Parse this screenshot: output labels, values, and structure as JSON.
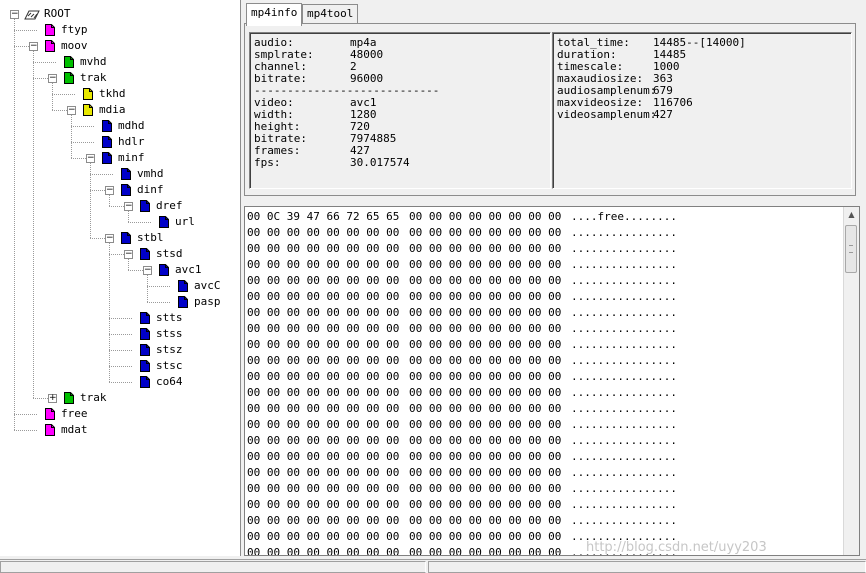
{
  "tree": {
    "root": "ROOT",
    "nodes": [
      {
        "label": "ftyp",
        "color": "#ff00ff"
      },
      {
        "label": "moov",
        "color": "#ff00ff"
      },
      {
        "label": "mvhd",
        "color": "#00c000"
      },
      {
        "label": "trak",
        "color": "#00c000"
      },
      {
        "label": "tkhd",
        "color": "#e8e800"
      },
      {
        "label": "mdia",
        "color": "#e8e800"
      },
      {
        "label": "mdhd",
        "color": "#0000c8"
      },
      {
        "label": "hdlr",
        "color": "#0000c8"
      },
      {
        "label": "minf",
        "color": "#0000c8"
      },
      {
        "label": "vmhd",
        "color": "#0000c8"
      },
      {
        "label": "dinf",
        "color": "#0000c8"
      },
      {
        "label": "dref",
        "color": "#0000c8"
      },
      {
        "label": "url",
        "color": "#0000c8"
      },
      {
        "label": "stbl",
        "color": "#0000c8"
      },
      {
        "label": "stsd",
        "color": "#0000c8"
      },
      {
        "label": "avc1",
        "color": "#0000c8"
      },
      {
        "label": "avcC",
        "color": "#0000c8"
      },
      {
        "label": "pasp",
        "color": "#0000c8"
      },
      {
        "label": "stts",
        "color": "#0000c8"
      },
      {
        "label": "stss",
        "color": "#0000c8"
      },
      {
        "label": "stsz",
        "color": "#0000c8"
      },
      {
        "label": "stsc",
        "color": "#0000c8"
      },
      {
        "label": "co64",
        "color": "#0000c8"
      },
      {
        "label": "trak",
        "color": "#00c000"
      },
      {
        "label": "free",
        "color": "#ff00ff"
      },
      {
        "label": "mdat",
        "color": "#ff00ff"
      }
    ]
  },
  "tabs": [
    "mp4info",
    "mp4tool"
  ],
  "info_left": [
    {
      "k": "audio:",
      "v": "mp4a"
    },
    {
      "k": "smplrate:",
      "v": "48000"
    },
    {
      "k": "channel:",
      "v": "2"
    },
    {
      "k": "bitrate:",
      "v": "96000"
    },
    {
      "k": "----------------------------",
      "v": ""
    },
    {
      "k": "video:",
      "v": "avc1"
    },
    {
      "k": "width:",
      "v": "1280"
    },
    {
      "k": "height:",
      "v": "720"
    },
    {
      "k": "bitrate:",
      "v": "7974885"
    },
    {
      "k": "frames:",
      "v": "427"
    },
    {
      "k": "fps:",
      "v": "30.017574"
    }
  ],
  "info_right": [
    {
      "k": "total_time:",
      "v": "14485--[14000]"
    },
    {
      "k": "duration:",
      "v": "14485"
    },
    {
      "k": "timescale:",
      "v": "1000"
    },
    {
      "k": "maxaudiosize:",
      "v": "363"
    },
    {
      "k": "audiosamplenum:",
      "v": "679"
    },
    {
      "k": "maxvideosize:",
      "v": "116706"
    },
    {
      "k": "videosamplenum:",
      "v": "427"
    }
  ],
  "hex": {
    "first": {
      "a": "00 0C 39 47 66 72 65 65",
      "b": "00 00 00 00 00 00 00 00",
      "c": "....free........"
    },
    "rest": {
      "a": "00 00 00 00 00 00 00 00",
      "b": "00 00 00 00 00 00 00 00",
      "c": "................"
    },
    "row_count": 22
  },
  "watermark": "http://blog.csdn.net/uyy203",
  "scroll": {
    "up": "▲",
    "down": "▼"
  }
}
